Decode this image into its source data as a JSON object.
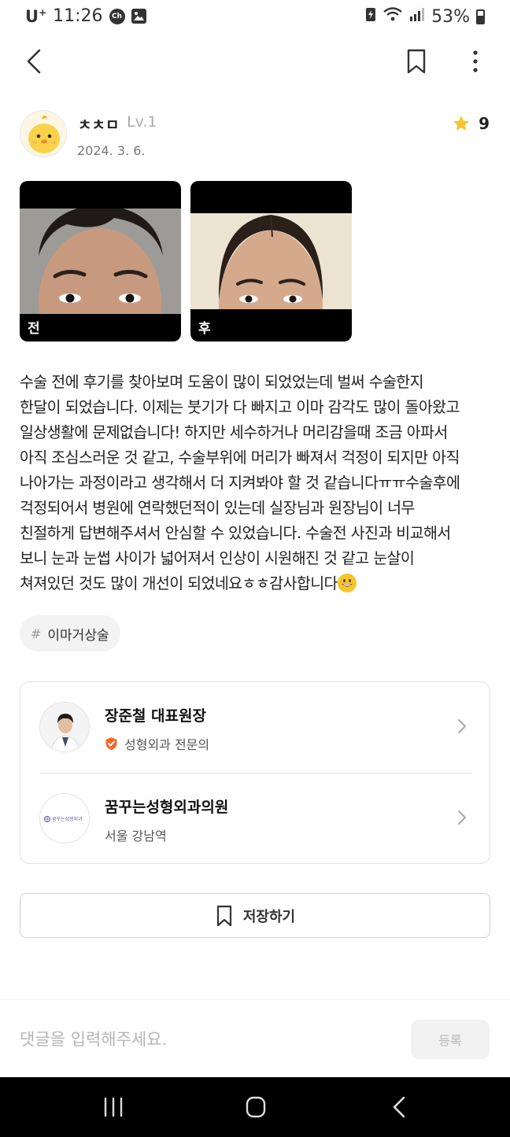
{
  "status_bar": {
    "carrier": "U",
    "carrier_sup": "+",
    "time": "11:26",
    "app_icon_text": "Ch",
    "battery": "53%"
  },
  "top_bar": {
    "back_icon": "chevron-left-icon",
    "bookmark_icon": "bookmark-icon",
    "more_icon": "more-vertical-icon"
  },
  "author": {
    "name": "ㅊㅊㅁ",
    "level": "Lv.1",
    "date": "2024. 3. 6.",
    "rating": "9",
    "star_color": "#f7c42c"
  },
  "photos": [
    {
      "label": "전"
    },
    {
      "label": "후"
    }
  ],
  "review_lines": [
    "수술 전에 후기를 찾아보며 도움이 많이 되었었는데 벌써 수술한지",
    "한달이 되었습니다. 이제는 붓기가 다 빠지고 이마 감각도 많이 돌아왔고",
    "일상생활에 문제없습니다! 하지만 세수하거나 머리감을때 조금 아파서",
    "아직 조심스러운 것 같고, 수술부위에 머리가 빠져서 걱정이 되지만 아직",
    "나아가는 과정이라고 생각해서 더 지켜봐야 할 것 같습니다ㅠㅠ수술후에",
    "걱정되어서 병원에 연락했던적이 있는데 실장님과 원장님이 너무",
    "친절하게 답변해주셔서 안심할 수 있었습니다. 수술전 사진과 비교해서",
    "보니 눈과 눈썹 사이가 넓어져서 인상이 시원해진 것 같고 눈살이",
    "쳐져있던 것도 많이 개선이 되었네요ㅎㅎ감사합니다"
  ],
  "tag": {
    "hash": "#",
    "label": "이마거상술"
  },
  "doctor": {
    "name": "장준철 대표원장",
    "specialty": "성형외과 전문의",
    "badge_color": "#f26a2e"
  },
  "clinic": {
    "name": "꿈꾸는성형외과의원",
    "location": "서울 강남역",
    "logo_text": "꿈꾸는성형외과"
  },
  "save_button": {
    "label": "저장하기"
  },
  "comment": {
    "placeholder": "댓글을 입력해주세요.",
    "submit_label": "등록"
  }
}
